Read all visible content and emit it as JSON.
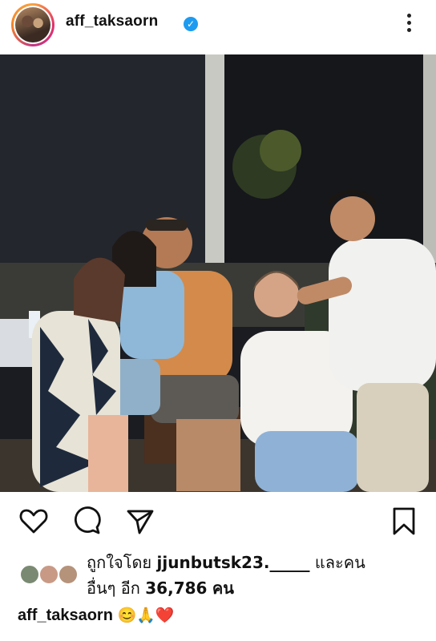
{
  "post": {
    "username": "aff_taksaorn",
    "verified_icon": "verified-badge-icon",
    "more_icon": "more-options-icon"
  },
  "photo": {
    "description_icon": "post-photo"
  },
  "actions": {
    "like_icon": "heart-icon",
    "comment_icon": "comment-icon",
    "share_icon": "share-icon",
    "save_icon": "bookmark-icon"
  },
  "likes": {
    "prefix": "ถูกใจโดย",
    "user": "jjunbutsk23._____",
    "mid": "และคน",
    "line2_prefix": "อื่นๆ อีก",
    "count": "36,786",
    "suffix": "คน"
  },
  "caption": {
    "username": "aff_taksaorn",
    "emojis": "😊🙏❤️"
  },
  "colors": {
    "verified": "#1d9bf0",
    "text": "#111111",
    "heart": "#e0245e"
  }
}
